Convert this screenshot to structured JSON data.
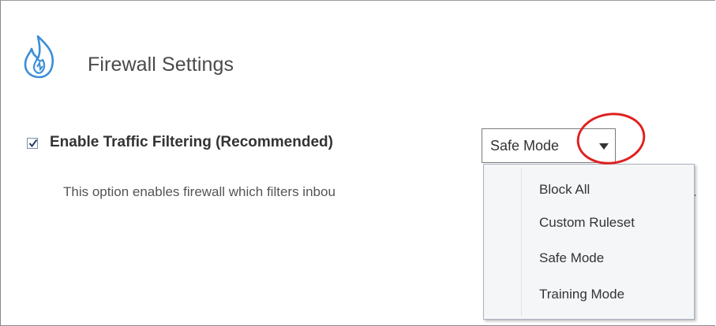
{
  "header": {
    "icon": "flame-icon",
    "title": "Firewall Settings"
  },
  "traffic_filtering": {
    "checked": true,
    "label": "Enable Traffic Filtering (Recommended)",
    "description": "This option enables firewall which filters inbou",
    "description_tail": "."
  },
  "mode_select": {
    "value": "Safe Mode",
    "arrow_icon": "triangle-down-icon",
    "options": [
      "Block All",
      "Custom Ruleset",
      "Safe Mode",
      "Training Mode"
    ]
  },
  "colors": {
    "icon_blue": "#3b8ed8",
    "annotation_red": "#e02020",
    "menu_background": "#f5f6f8"
  }
}
